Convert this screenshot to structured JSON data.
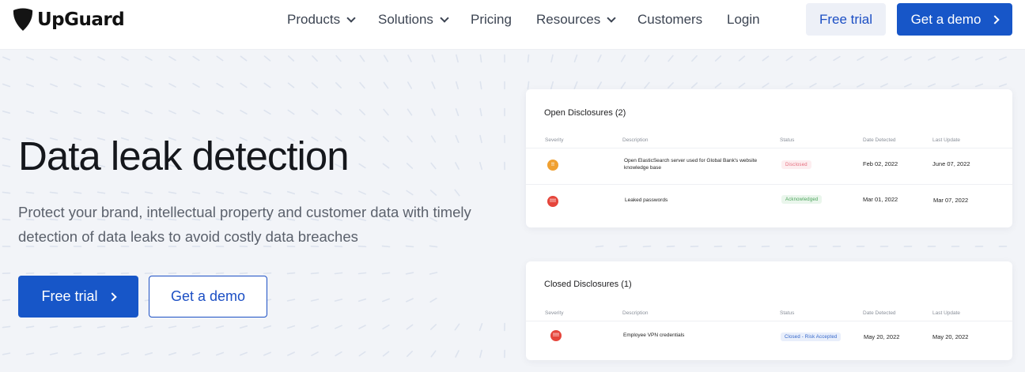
{
  "brand": {
    "name": "UpGuard"
  },
  "nav": {
    "items": [
      {
        "label": "Products",
        "dropdown": true
      },
      {
        "label": "Solutions",
        "dropdown": true
      },
      {
        "label": "Pricing",
        "dropdown": false
      },
      {
        "label": "Resources",
        "dropdown": true
      },
      {
        "label": "Customers",
        "dropdown": false
      },
      {
        "label": "Login",
        "dropdown": false
      }
    ],
    "free_trial_label": "Free trial",
    "get_demo_label": "Get a demo"
  },
  "hero": {
    "title": "Data leak detection",
    "subtitle": "Protect your brand, intellectual property and customer data with timely detection of data leaks to avoid costly data breaches",
    "primary_cta": "Free trial",
    "secondary_cta": "Get a demo"
  },
  "colors": {
    "accent": "#1756c8",
    "severity_high": "#f0a030",
    "severity_critical": "#e5453b",
    "status_disclosed": "#e5697a",
    "status_acknowledged": "#4aa35a",
    "status_closed": "#2f63c8"
  },
  "open_disclosures": {
    "title": "Open Disclosures (2)",
    "columns": [
      "Severity",
      "Description",
      "Status",
      "Date Detected",
      "Last Update"
    ],
    "rows": [
      {
        "severity": "high",
        "severity_glyph": "!!",
        "description": "Open ElasticSearch server used for Global Bank's website knowledge base",
        "status": "Disclosed",
        "date_detected": "Feb 02, 2022",
        "last_update": "June 07, 2022"
      },
      {
        "severity": "critical",
        "severity_glyph": "!!!!",
        "description": "Leaked passwords",
        "status": "Acknowledged",
        "date_detected": "Mar 01, 2022",
        "last_update": "Mar 07, 2022"
      }
    ]
  },
  "closed_disclosures": {
    "title": "Closed Disclosures (1)",
    "columns": [
      "Severity",
      "Description",
      "Status",
      "Date Detected",
      "Last Update"
    ],
    "rows": [
      {
        "severity": "critical",
        "severity_glyph": "!!!!",
        "description": "Employee VPN credentials",
        "status": "Closed - Risk Accepted",
        "date_detected": "May 20, 2022",
        "last_update": "May 20, 2022"
      }
    ]
  }
}
